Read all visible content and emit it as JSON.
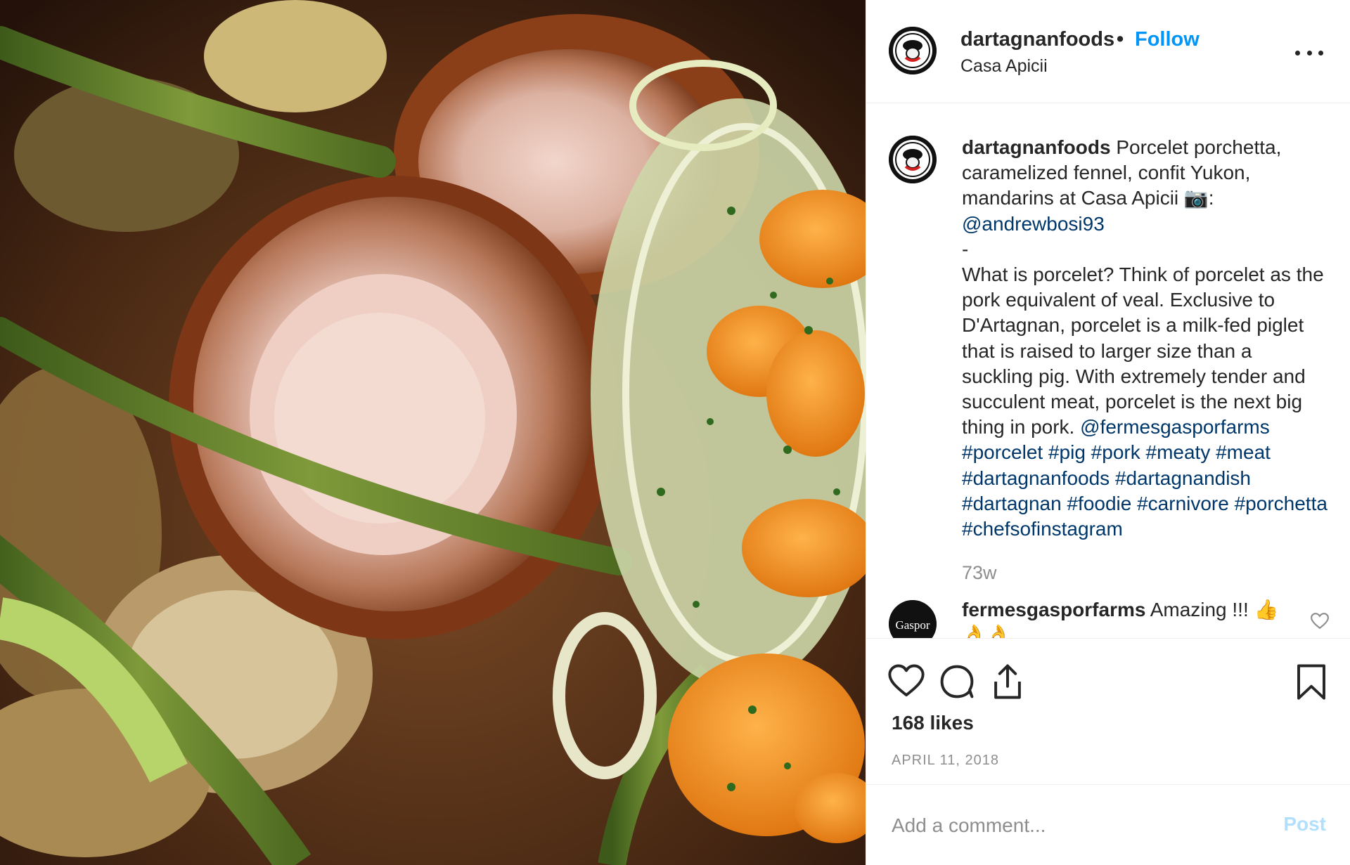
{
  "header": {
    "username": "dartagnanfoods",
    "separator": "•",
    "follow_label": "Follow",
    "location": "Casa Apicii"
  },
  "caption": {
    "username": "dartagnanfoods",
    "line1": " Porcelet porchetta, caramelized fennel, confit Yukon, mandarins at Casa Apicii 📷:",
    "mention1": "@andrewbosi93",
    "dash": "-",
    "body": "What is porcelet? Think of porcelet as the pork equivalent of veal. Exclusive to D'Artagnan, porcelet is a milk-fed piglet that is raised to larger size than a suckling pig. With extremely tender and succulent meat, porcelet is the next big thing in pork. ",
    "mention2": "@fermesgasporfarms",
    "hashtags": "#porcelet #pig #pork #meaty #meat #dartagnanfoods #dartagnandish #dartagnan #foodie #carnivore #porchetta #chefsofinstagram",
    "age": "73w"
  },
  "comment": {
    "username": "fermesgasporfarms",
    "text": " Amazing !!! 👍👌👌",
    "avatar_text": "Gaspor"
  },
  "actions": {
    "likes": "168 likes",
    "date": "APRIL 11, 2018"
  },
  "add_comment": {
    "placeholder": "Add a comment...",
    "post_label": "Post"
  },
  "icons": {
    "like": "heart-icon",
    "comment": "comment-bubble-icon",
    "share": "share-icon",
    "save": "bookmark-icon",
    "more": "more-dots-icon",
    "comment_like": "small-heart-icon"
  },
  "colors": {
    "accent": "#0095f6",
    "link": "#00376b",
    "muted": "#8e8e8e",
    "post_disabled": "#b2dffc"
  }
}
